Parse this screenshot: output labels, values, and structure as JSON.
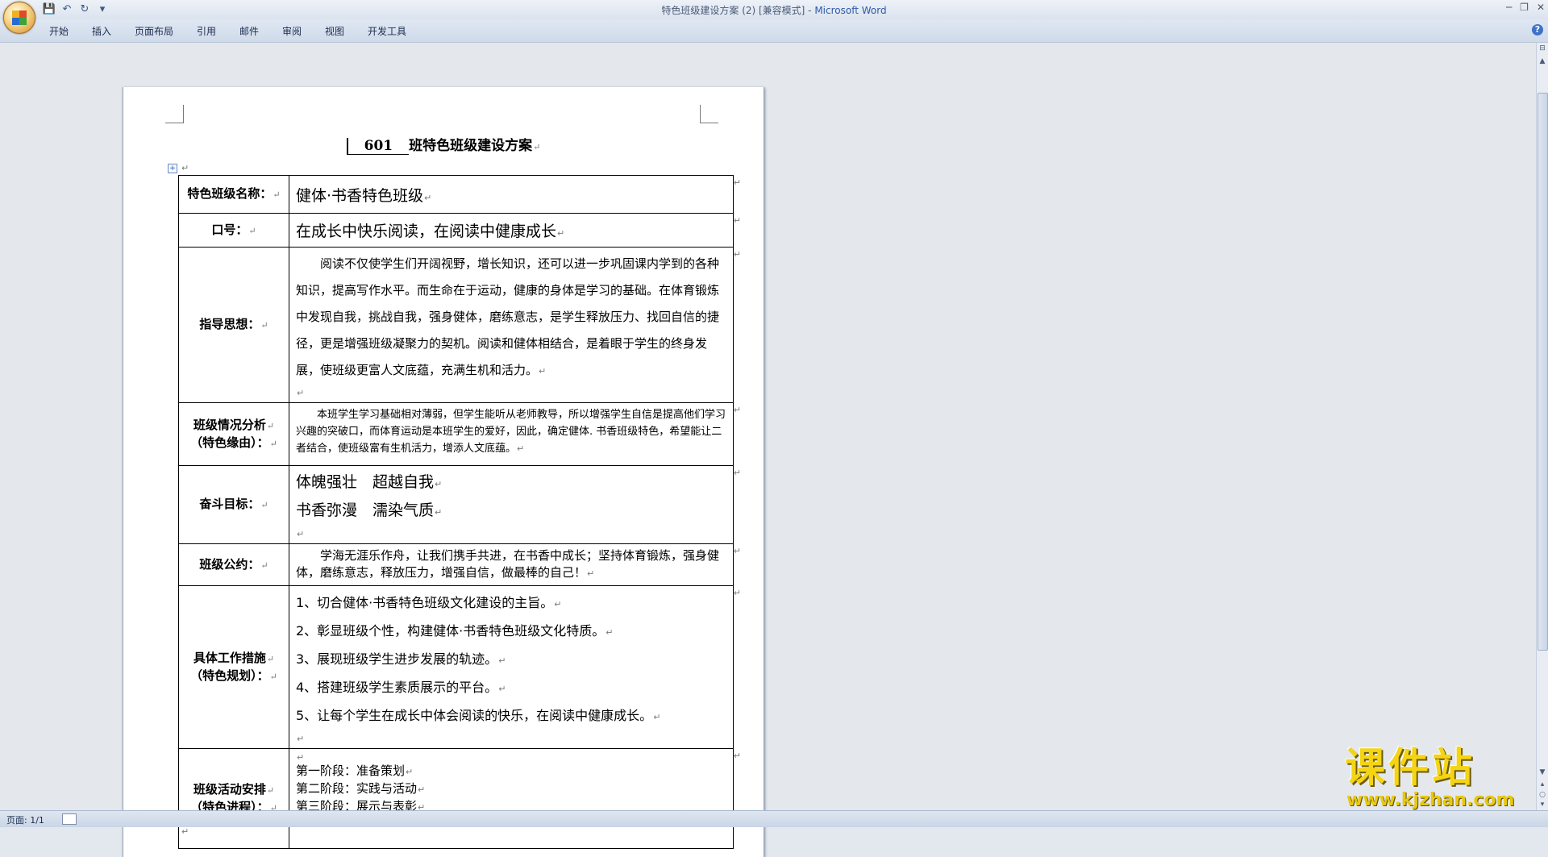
{
  "window": {
    "title_doc": "特色班级建设方案 (2) [兼容模式] - ",
    "title_app": "Microsoft Word"
  },
  "ribbon": {
    "tabs": [
      "开始",
      "插入",
      "页面布局",
      "引用",
      "邮件",
      "审阅",
      "视图",
      "开发工具"
    ]
  },
  "document": {
    "title_number": "601",
    "title_text": "班特色班级建设方案",
    "rows": [
      {
        "label": "特色班级名称：",
        "content": "健体·书香特色班级"
      },
      {
        "label": "口号：",
        "content": "在成长中快乐阅读，在阅读中健康成长"
      },
      {
        "label": "指导思想：",
        "content": "阅读不仅使学生们开阔视野，增长知识，还可以进一步巩固课内学到的各种知识，提高写作水平。而生命在于运动，健康的身体是学习的基础。在体育锻炼中发现自我，挑战自我，强身健体，磨练意志，是学生释放压力、找回自信的捷径，更是增强班级凝聚力的契机。阅读和健体相结合，是着眼于学生的终身发展，使班级更富人文底蕴，充满生机和活力。"
      },
      {
        "label_line1": "班级情况分析",
        "label_line2": "（特色缘由）：",
        "content": "本班学生学习基础相对薄弱，但学生能听从老师教导，所以增强学生自信是提高他们学习兴趣的突破口，而体育运动是本班学生的爱好，因此，确定健体. 书香班级特色，希望能让二者结合，使班级富有生机活力，增添人文底蕴。"
      },
      {
        "label": "奋斗目标：",
        "line1": "体魄强壮　超越自我",
        "line2": "书香弥漫　濡染气质"
      },
      {
        "label": "班级公约：",
        "content": "学海无涯乐作舟，让我们携手共进，在书香中成长；坚持体育锻炼，强身健体，磨练意志，释放压力，增强自信，做最棒的自己！"
      },
      {
        "label_line1": "具体工作措施",
        "label_line2": "（特色规划）：",
        "items": [
          "1、切合健体·书香特色班级文化建设的主旨。",
          "2、彰显班级个性，构建健体·书香特色班级文化特质。",
          "3、展现班级学生进步发展的轨迹。",
          "4、搭建班级学生素质展示的平台。",
          "5、让每个学生在成长中体会阅读的快乐，在阅读中健康成长。"
        ]
      },
      {
        "label_line1": "班级活动安排",
        "label_line2": "（特色进程）：",
        "stages": [
          "第一阶段：准备策划",
          "第二阶段：实践与活动",
          "第三阶段：展示与表彰"
        ]
      }
    ]
  },
  "status": {
    "page": "页面: 1/1"
  },
  "watermark": {
    "cn": "课件站",
    "url": "www.kjzhan.com"
  }
}
